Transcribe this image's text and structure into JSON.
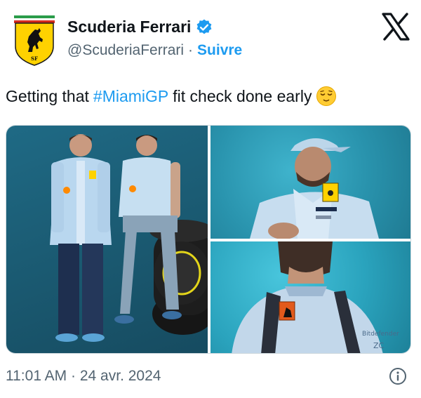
{
  "author": {
    "name": "Scuderia Ferrari",
    "handle": "@ScuderiaFerrari",
    "separator": "·",
    "follow_label": "Suivre"
  },
  "tweet": {
    "text_before": "Getting that",
    "hashtag": "#MiamiGP",
    "text_after": "fit check done early",
    "emoji": "relieved-face-emoji"
  },
  "media": {
    "photos": [
      {
        "kind": "two-drivers-standing"
      },
      {
        "kind": "driver-cap-portrait"
      },
      {
        "kind": "driver-back-view"
      }
    ],
    "jacket_lettering": [
      "Bitdefender",
      "ZC"
    ]
  },
  "footer": {
    "time": "11:01 AM",
    "separator": "·",
    "date": "24 avr. 2024"
  },
  "colors": {
    "accent": "#1d9bf0",
    "text": "#0f1419",
    "muted": "#536471",
    "ferrari_yellow": "#ffd200"
  },
  "icons": [
    "ferrari-logo",
    "verified-badge-icon",
    "x-logo-icon",
    "info-icon"
  ]
}
